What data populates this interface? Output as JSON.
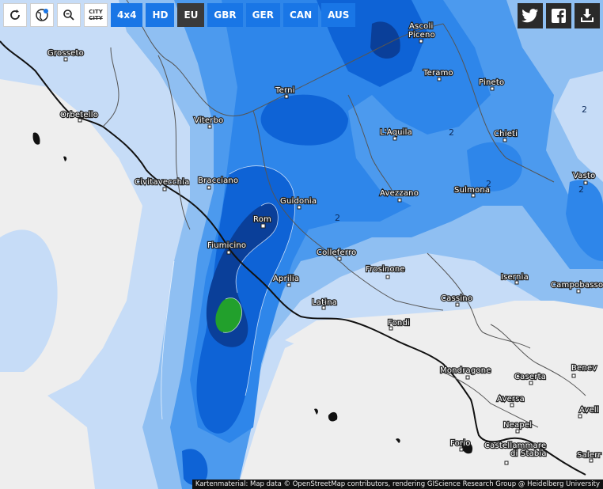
{
  "toolbar": {
    "buttons": [
      "4x4",
      "HD",
      "EU",
      "GBR",
      "GER",
      "CAN",
      "AUS"
    ],
    "city_top": "CITY",
    "city_bottom": "CITY"
  },
  "colors": {
    "sea": "#f0f0f0",
    "level1": "#c8def8",
    "level2": "#8fbff2",
    "level3": "#4c9aee",
    "level4": "#1f78e6",
    "level5": "#0b5cd0",
    "level6": "#0a3f99",
    "level7": "#1e9e2a",
    "button_active": "#3a3a3a",
    "button_blue": "#1976e6"
  },
  "cities": [
    {
      "name": "Grosseto"
    },
    {
      "name": "Orbetello"
    },
    {
      "name": "Viterbo"
    },
    {
      "name": "Terni"
    },
    {
      "name": "Ascoli"
    },
    {
      "name": "Piceno"
    },
    {
      "name": "Teramo"
    },
    {
      "name": "Pineto"
    },
    {
      "name": "L'Aquila"
    },
    {
      "name": "Chieti"
    },
    {
      "name": "Civitavecchia"
    },
    {
      "name": "Bracciano"
    },
    {
      "name": "Guidonia"
    },
    {
      "name": "Avezzano"
    },
    {
      "name": "Sulmona"
    },
    {
      "name": "Vasto"
    },
    {
      "name": "Rom"
    },
    {
      "name": "Fiumicino"
    },
    {
      "name": "Colleferro"
    },
    {
      "name": "Frosinone"
    },
    {
      "name": "Aprilia"
    },
    {
      "name": "Isernia"
    },
    {
      "name": "Campobasso"
    },
    {
      "name": "Latina"
    },
    {
      "name": "Cassino"
    },
    {
      "name": "Fondi"
    },
    {
      "name": "Mondragone"
    },
    {
      "name": "Caserta"
    },
    {
      "name": "Benev"
    },
    {
      "name": "Aversa"
    },
    {
      "name": "Avell"
    },
    {
      "name": "Neapel"
    },
    {
      "name": "Forio"
    },
    {
      "name": "Castellammare"
    },
    {
      "name": "di Stabia"
    },
    {
      "name": "Salerr"
    }
  ],
  "contour_labels": [
    "2",
    "2",
    "2",
    "2",
    "2",
    "2"
  ],
  "attribution": "Kartenmaterial: Map data © OpenStreetMap contributors, rendering GIScience Research Group @ Heidelberg University"
}
